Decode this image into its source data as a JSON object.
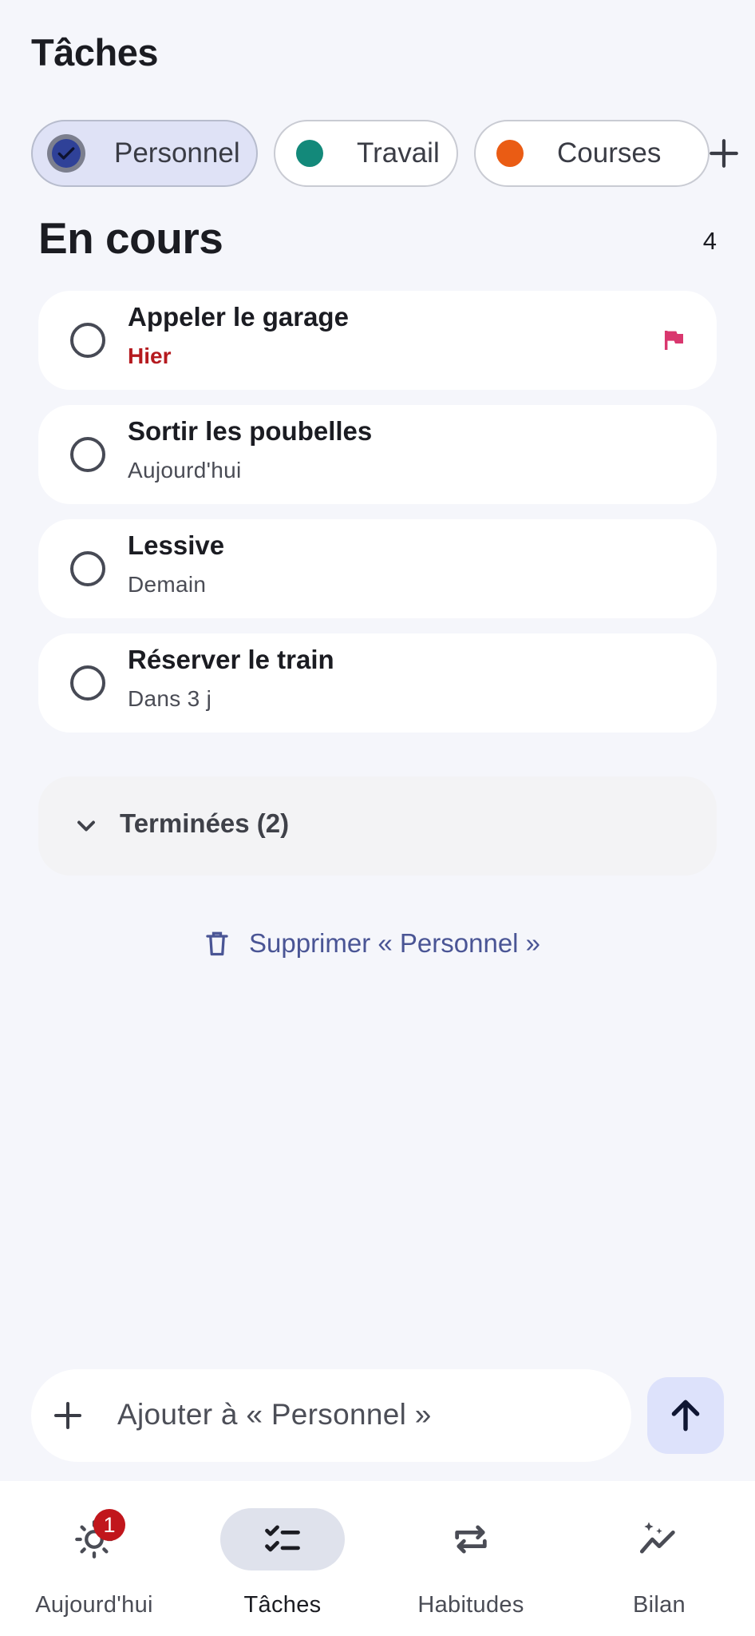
{
  "page": {
    "title": "Tâches"
  },
  "chips": [
    {
      "label": "Personnel",
      "selected": true,
      "color": "#2f4198"
    },
    {
      "label": "Travail",
      "selected": false,
      "color": "#13897a"
    },
    {
      "label": "Courses",
      "selected": false,
      "color": "#ea5c14"
    }
  ],
  "add_chip_icon": "plus-icon",
  "section": {
    "title": "En cours",
    "count": "4"
  },
  "tasks": [
    {
      "title": "Appeler le garage",
      "due": "Hier",
      "overdue": true,
      "flagged": true,
      "flag_color": "#d9376e"
    },
    {
      "title": "Sortir les poubelles",
      "due": "Aujourd'hui",
      "overdue": false,
      "flagged": false
    },
    {
      "title": "Lessive",
      "due": "Demain",
      "overdue": false,
      "flagged": false
    },
    {
      "title": "Réserver le train",
      "due": "Dans 3 j",
      "overdue": false,
      "flagged": false
    }
  ],
  "completed": {
    "label": "Terminées (2)",
    "expanded": false
  },
  "delete_list": {
    "label": "Supprimer « Personnel »",
    "icon": "trash-icon"
  },
  "add_bar": {
    "placeholder": "Ajouter à « Personnel »",
    "send_icon": "arrow-up-icon"
  },
  "nav": [
    {
      "label": "Aujourd'hui",
      "icon": "sun-icon",
      "badge": "1",
      "active": false
    },
    {
      "label": "Tâches",
      "icon": "checklist-icon",
      "active": true
    },
    {
      "label": "Habitudes",
      "icon": "repeat-icon",
      "active": false
    },
    {
      "label": "Bilan",
      "icon": "trend-icon",
      "active": false
    }
  ],
  "colors": {
    "background": "#f5f6fb",
    "accent": "#2f4198",
    "overdue": "#b51a1f",
    "link": "#4a5595",
    "badge": "#c1161c"
  }
}
